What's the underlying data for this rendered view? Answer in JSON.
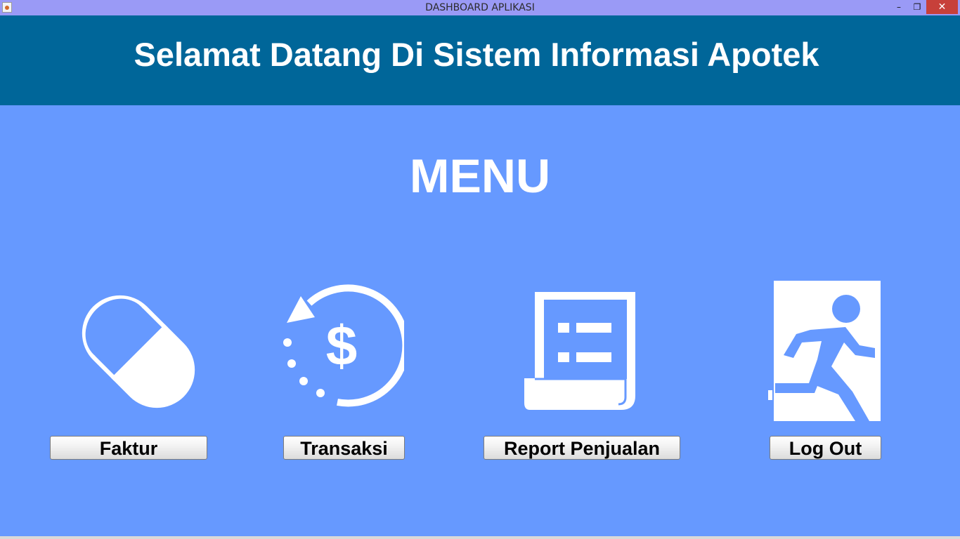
{
  "window": {
    "title": "DASHBOARD APLIKASI",
    "minimize": "–",
    "maximize": "❐",
    "close": "✕"
  },
  "header": {
    "title": "Selamat Datang Di Sistem Informasi Apotek"
  },
  "menu": {
    "title": "MENU",
    "items": [
      {
        "label": "Faktur",
        "icon": "pill-capsule-icon"
      },
      {
        "label": "Transaksi",
        "icon": "dollar-history-icon"
      },
      {
        "label": "Report Penjualan",
        "icon": "receipt-report-icon"
      },
      {
        "label": "Log Out",
        "icon": "exit-door-icon"
      }
    ]
  },
  "colors": {
    "background": "#6699ff",
    "header": "#006699",
    "titlebar": "#9a9af6",
    "close": "#c7403a"
  }
}
